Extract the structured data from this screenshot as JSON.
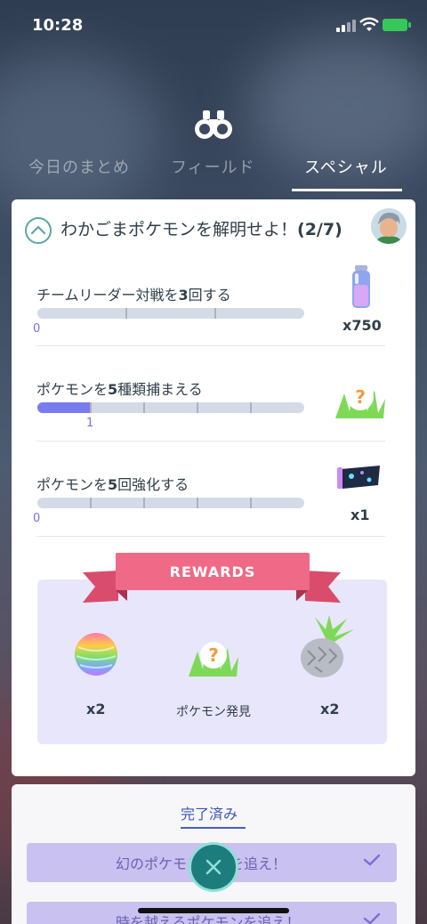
{
  "status": {
    "time": "10:28"
  },
  "tabs": [
    {
      "label": "今日のまとめ"
    },
    {
      "label": "フィールド"
    },
    {
      "label": "スペシャル"
    }
  ],
  "card": {
    "title": "わかごまポケモンを解明せよ！",
    "progress": "(2/7)"
  },
  "tasks": [
    {
      "label_pre": "チームリーダー対戦を",
      "label_num": "3",
      "label_post": "回する",
      "progress_text": "0",
      "progress_fraction": 0,
      "reward_count": "x750",
      "reward_icon": "stardust-icon"
    },
    {
      "label_pre": "ポケモンを",
      "label_num": "5",
      "label_post": "種類捕まえる",
      "progress_text": "1",
      "progress_fraction": 0.2,
      "reward_count": "",
      "reward_icon": "pokemon-encounter-icon"
    },
    {
      "label_pre": "ポケモンを",
      "label_num": "5",
      "label_post": "回強化する",
      "progress_text": "0",
      "progress_fraction": 0,
      "reward_count": "x1",
      "reward_icon": "glacial-lure-icon"
    }
  ],
  "rewards": {
    "banner": "REWARDS",
    "items": [
      {
        "icon": "rare-candy-icon",
        "label": "x2"
      },
      {
        "icon": "pokemon-encounter-icon",
        "label": "ポケモン発見"
      },
      {
        "icon": "silver-pinap-berry-icon",
        "label": "x2"
      }
    ]
  },
  "completed": {
    "tab_label": "完了済み",
    "items": [
      {
        "label": "幻のポケモンの跡を追え！"
      },
      {
        "label": "時を越えるポケモンを追え！"
      }
    ]
  },
  "colors": {
    "accent": "#7b7bf0",
    "ribbon": "#ee6a86",
    "teal": "#1d7c7c"
  }
}
